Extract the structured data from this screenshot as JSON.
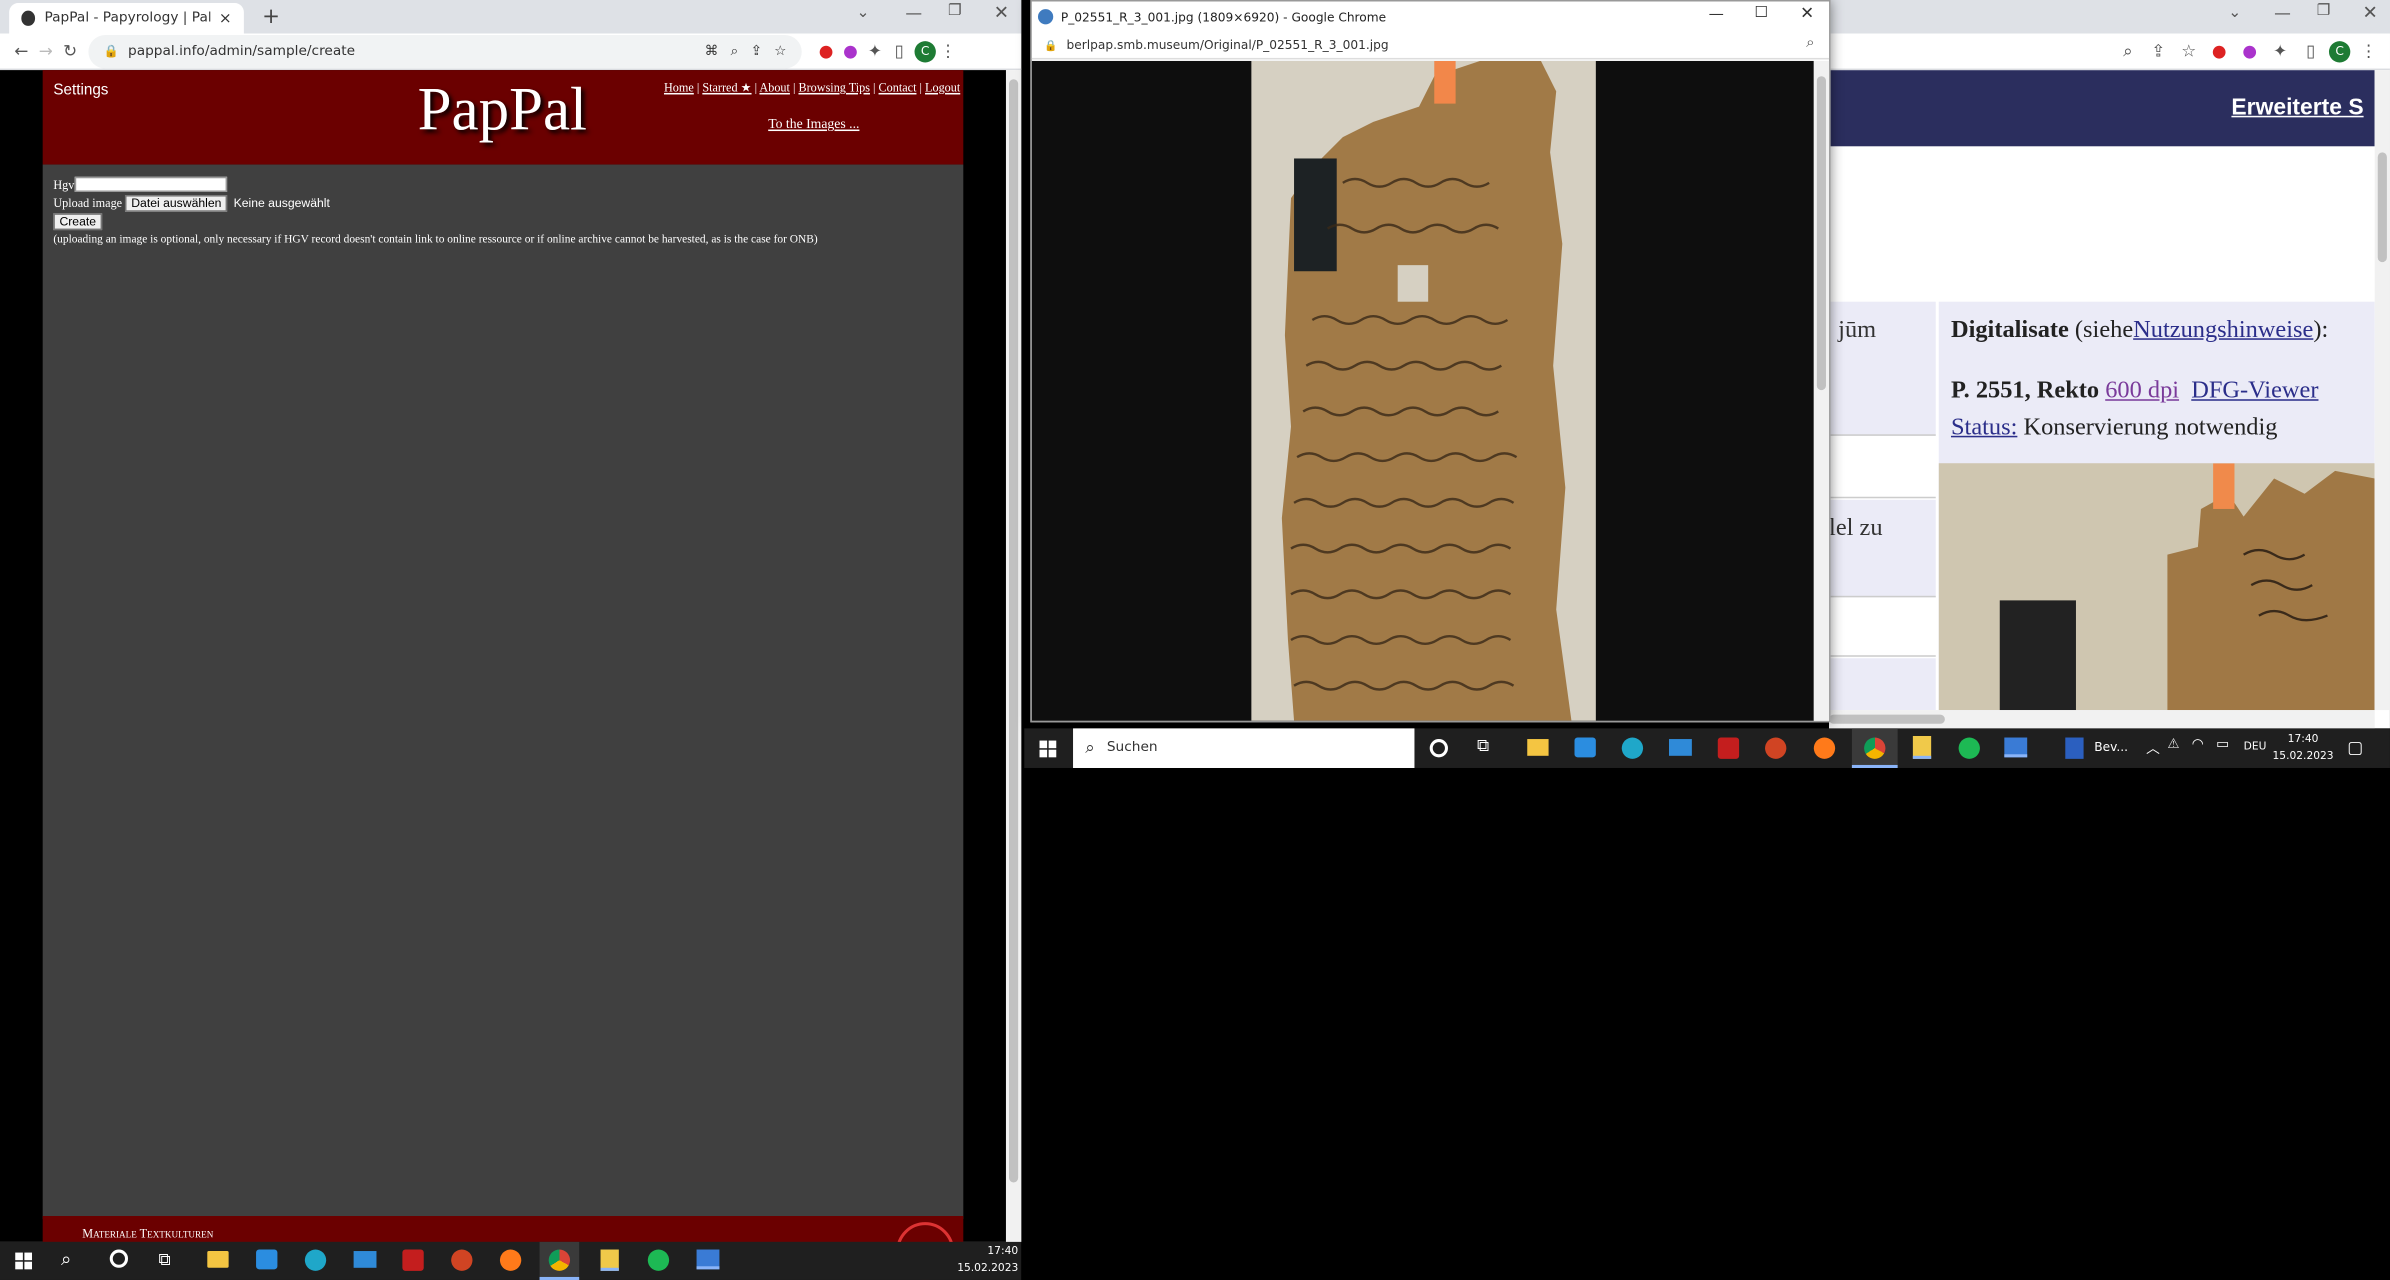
{
  "left_window": {
    "tab_title": "PapPal - Papyrology | Paleograph",
    "url": "pappal.info/admin/sample/create",
    "profile_letter": "C",
    "site": {
      "settings": "Settings",
      "logo": "PapPal",
      "nav": [
        "Home",
        "Starred ★",
        "About",
        "Browsing Tips",
        "Contact",
        "Logout"
      ],
      "to_images": "To the Images ...",
      "form": {
        "hgv_label": "Hgv",
        "upload_label": "Upload image",
        "file_button": "Datei auswählen",
        "file_status": "Keine ausgewählt",
        "create_button": "Create",
        "note": "(uploading an image is optional, only necessary if HGV record doesn't contain link to online ressource or if online archive cannot be harvested, as is the case for ONB)"
      },
      "footer_text": "Materiale Textkulturen"
    }
  },
  "popup_window": {
    "title": "P_02551_R_3_001.jpg (1809×6920) - Google Chrome",
    "url": "berlpap.smb.museum/Original/P_02551_R_3_001.jpg"
  },
  "right_window": {
    "header_link": "Erweiterte S",
    "partial_text_1": "jūm",
    "partial_text_2": "lel zu",
    "digitalisate_label": "Digitalisate",
    "siehe_open": "(siehe",
    "nutzung_link": "Nutzungshinweise",
    "siehe_close": "):",
    "rekto_label": "P. 2551, Rekto",
    "dpi_link": "600 dpi",
    "dfg_link": "DFG-Viewer",
    "status_label": "Status:",
    "status_value": "Konservierung notwendig"
  },
  "taskbar_bottom": {
    "time": "17:40",
    "date": "15.02.2023"
  },
  "taskbar_mid": {
    "search_placeholder": "Suchen",
    "app_label": "Bev...",
    "lang": "DEU",
    "time": "17:40",
    "date": "15.02.2023"
  },
  "colors": {
    "maroon": "#6b0000",
    "page_gray": "#404040",
    "right_header": "#2b2e5e"
  }
}
